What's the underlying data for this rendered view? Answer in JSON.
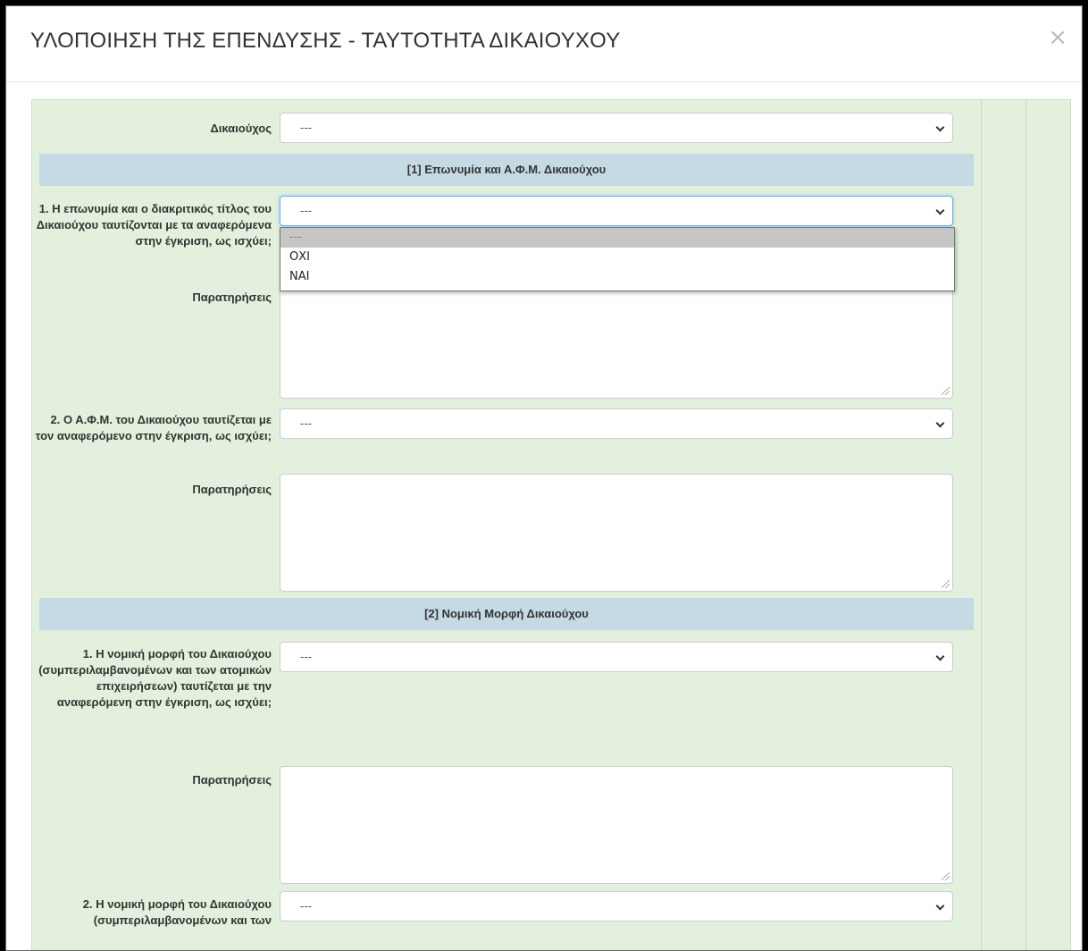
{
  "modal": {
    "title": "ΥΛΟΠΟΙΗΣΗ ΤΗΣ ΕΠΕΝΔΥΣΗΣ - ΤΑΥΤΟΤΗΤΑ ΔΙΚΑΙΟΥΧΟΥ",
    "close": "×"
  },
  "form": {
    "beneficiary": {
      "label": "Δικαιούχος",
      "value": "---"
    },
    "section1": {
      "title": "[1] Επωνυμία και Α.Φ.Μ. Δικαιούχου",
      "q1": {
        "label": "1. Η επωνυμία και ο διακριτικός τίτλος του Δικαιούχου ταυτίζονται με τα αναφερόμενα στην έγκριση, ως ισχύει;",
        "value": "---",
        "options": [
          "---",
          "ΟΧΙ",
          "ΝΑΙ"
        ]
      },
      "notes1_label": "Παρατηρήσεις",
      "q2": {
        "label": "2. Ο Α.Φ.Μ. του Δικαιούχου ταυτίζεται με τον αναφερόμενο στην έγκριση, ως ισχύει;",
        "value": "---"
      },
      "notes2_label": "Παρατηρήσεις"
    },
    "section2": {
      "title": "[2] Νομική Μορφή Δικαιούχου",
      "q1": {
        "label": "1. Η νομική μορφή του Δικαιούχου (συμπεριλαμβανομένων και των ατομικών επιχειρήσεων) ταυτίζεται με την αναφερόμενη στην έγκριση, ως ισχύει;",
        "value": "---"
      },
      "notes1_label": "Παρατηρήσεις",
      "q2": {
        "label": "2. Η νομική μορφή του Δικαιούχου (συμπεριλαμβανομένων και των",
        "value": "---"
      }
    }
  }
}
